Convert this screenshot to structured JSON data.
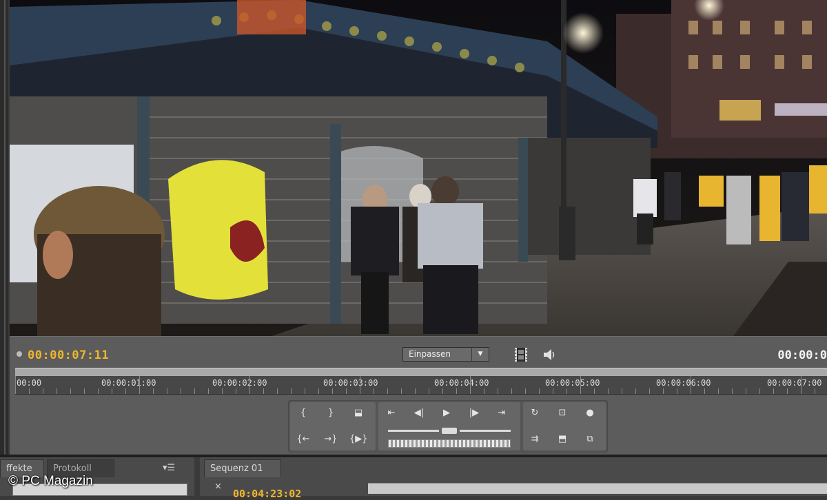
{
  "monitor": {
    "current_timecode": "00:00:07:11",
    "duration_timecode": "00:00:0",
    "fit_select_value": "Einpassen",
    "ruler_labels": [
      "00:00",
      "00:00:01:00",
      "00:00:02:00",
      "00:00:03:00",
      "00:00:04:00",
      "00:00:05:00",
      "00:00:06:00",
      "00:00:07:00"
    ]
  },
  "transport": {
    "buttons": [
      {
        "name": "set-in-point-icon",
        "glyph": "{"
      },
      {
        "name": "set-out-point-icon",
        "glyph": "}"
      },
      {
        "name": "marker-icon",
        "glyph": "⬓"
      },
      {
        "name": "go-to-in-icon",
        "glyph": "⇤"
      },
      {
        "name": "step-back-icon",
        "glyph": "◀|"
      },
      {
        "name": "play-icon",
        "glyph": "▶"
      },
      {
        "name": "step-forward-icon",
        "glyph": "|▶"
      },
      {
        "name": "go-to-out-icon",
        "glyph": "⇥"
      },
      {
        "name": "go-to-previous-edit-icon",
        "glyph": "{←"
      },
      {
        "name": "go-to-next-edit-icon",
        "glyph": "→}"
      },
      {
        "name": "play-in-to-out-icon",
        "glyph": "{▶}"
      },
      {
        "name": "loop-icon",
        "glyph": "↻"
      },
      {
        "name": "safe-margins-icon",
        "glyph": "⊡"
      },
      {
        "name": "output-icon",
        "glyph": "●"
      },
      {
        "name": "insert-icon",
        "glyph": "⇉"
      },
      {
        "name": "overlay-icon",
        "glyph": "⬒"
      },
      {
        "name": "export-frame-icon",
        "glyph": "⧉"
      }
    ]
  },
  "bottom": {
    "left_tabs": [
      "ffekte",
      "Protokoll"
    ],
    "left_menu_glyph": "▾☰",
    "right_tab": "Sequenz 01",
    "right_tab_close": "×",
    "sequence_timecode": "00:04:23:02"
  },
  "copyright": "© PC Magazin",
  "colors": {
    "timecode": "#f0b62b",
    "panel": "#5c5c5c"
  }
}
